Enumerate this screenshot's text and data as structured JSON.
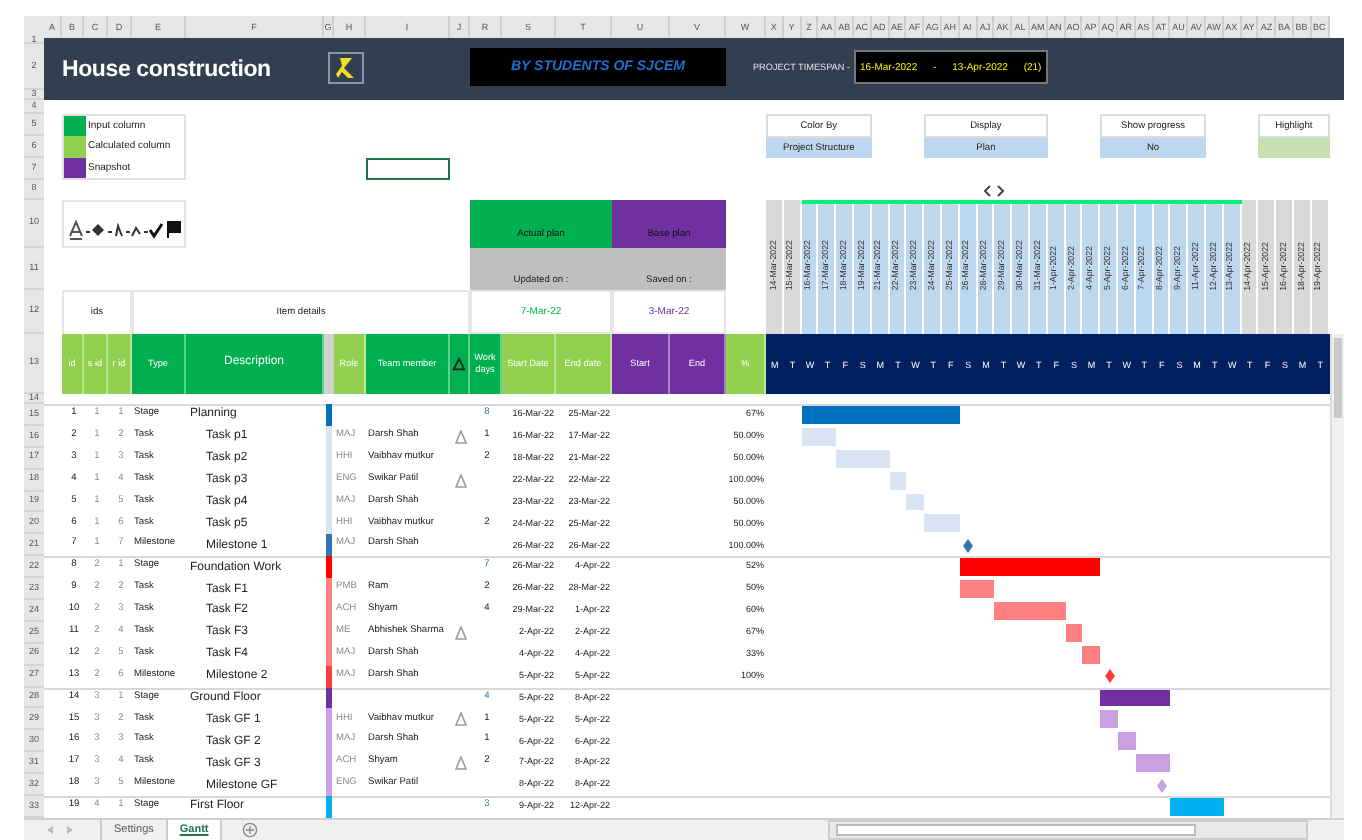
{
  "sheet": {
    "column_letters": [
      "A",
      "B",
      "C",
      "D",
      "E",
      "F",
      "G",
      "H",
      "I",
      "J",
      "R",
      "S",
      "T",
      "U",
      "V",
      "W",
      "X",
      "Y",
      "Z",
      "AA",
      "AB",
      "AC",
      "AD",
      "AE",
      "AF",
      "AG",
      "AH",
      "AI",
      "AJ",
      "AK",
      "AL",
      "AM",
      "AN",
      "AO",
      "AP",
      "AQ",
      "AR",
      "AS",
      "AT",
      "AU",
      "AV",
      "AW",
      "AX",
      "AY",
      "AZ",
      "BA",
      "BB",
      "BC"
    ],
    "row_numbers": [
      "1",
      "2",
      "3",
      "4",
      "5",
      "6",
      "7",
      "8",
      "10",
      "11",
      "12",
      "13",
      "14",
      "15",
      "16",
      "17",
      "18",
      "19",
      "20",
      "21",
      "22",
      "23",
      "24",
      "25",
      "26",
      "27",
      "28",
      "29",
      "30",
      "31",
      "32",
      "33"
    ]
  },
  "title": "House construction",
  "banner": "BY STUDENTS OF SJCEM",
  "timespan": {
    "label": "PROJECT TIMESPAN -",
    "start": "16-Mar-2022",
    "separator": "-",
    "end": "13-Apr-2022",
    "days": "(21)"
  },
  "legend": [
    {
      "label": "Input column",
      "color": "#00b050"
    },
    {
      "label": "Calculated column",
      "color": "#92d050"
    },
    {
      "label": "Snapshot",
      "color": "#7030a0"
    }
  ],
  "selectors": [
    {
      "kind": "dropdown",
      "label": "Color By",
      "value": "Project Structure"
    },
    {
      "kind": "dropdown",
      "label": "Display",
      "value": "Plan"
    },
    {
      "kind": "dropdown",
      "label": "Show progress",
      "value": "No"
    },
    {
      "kind": "swatch",
      "label": "Highlight"
    }
  ],
  "plans": [
    {
      "title": "Actual plan",
      "caption": "Updated on :",
      "date": "7-Mar-22",
      "kind": "actual"
    },
    {
      "title": "Base plan",
      "caption": "Saved on :",
      "date": "3-Mar-22",
      "kind": "base"
    }
  ],
  "group_headers": [
    "ids",
    "Item details"
  ],
  "columns": [
    "id",
    "s id",
    "r id",
    "Type",
    "Description",
    "Role",
    "Team member",
    "Work days",
    "Start Date",
    "End date",
    "Start",
    "End",
    "%"
  ],
  "days": [
    {
      "date": "14-Mar-2022",
      "weekday": "M",
      "highlighted": false
    },
    {
      "date": "15-Mar-2022",
      "weekday": "T",
      "highlighted": false
    },
    {
      "date": "16-Mar-2022",
      "weekday": "W",
      "highlighted": true
    },
    {
      "date": "17-Mar-2022",
      "weekday": "T",
      "highlighted": true
    },
    {
      "date": "18-Mar-2022",
      "weekday": "F",
      "highlighted": true
    },
    {
      "date": "19-Mar-2022",
      "weekday": "S",
      "highlighted": true
    },
    {
      "date": "21-Mar-2022",
      "weekday": "M",
      "highlighted": true
    },
    {
      "date": "22-Mar-2022",
      "weekday": "T",
      "highlighted": true
    },
    {
      "date": "23-Mar-2022",
      "weekday": "W",
      "highlighted": true
    },
    {
      "date": "24-Mar-2022",
      "weekday": "T",
      "highlighted": true
    },
    {
      "date": "25-Mar-2022",
      "weekday": "F",
      "highlighted": true
    },
    {
      "date": "26-Mar-2022",
      "weekday": "S",
      "highlighted": true
    },
    {
      "date": "28-Mar-2022",
      "weekday": "M",
      "highlighted": true
    },
    {
      "date": "29-Mar-2022",
      "weekday": "T",
      "highlighted": true
    },
    {
      "date": "30-Mar-2022",
      "weekday": "W",
      "highlighted": true
    },
    {
      "date": "31-Mar-2022",
      "weekday": "T",
      "highlighted": true
    },
    {
      "date": "1-Apr-2022",
      "weekday": "F",
      "highlighted": true
    },
    {
      "date": "2-Apr-2022",
      "weekday": "S",
      "highlighted": true
    },
    {
      "date": "4-Apr-2022",
      "weekday": "M",
      "highlighted": true
    },
    {
      "date": "5-Apr-2022",
      "weekday": "T",
      "highlighted": true
    },
    {
      "date": "6-Apr-2022",
      "weekday": "W",
      "highlighted": true
    },
    {
      "date": "7-Apr-2022",
      "weekday": "T",
      "highlighted": true
    },
    {
      "date": "8-Apr-2022",
      "weekday": "F",
      "highlighted": true
    },
    {
      "date": "9-Apr-2022",
      "weekday": "S",
      "highlighted": true
    },
    {
      "date": "11-Apr-2022",
      "weekday": "M",
      "highlighted": true
    },
    {
      "date": "12-Apr-2022",
      "weekday": "T",
      "highlighted": true
    },
    {
      "date": "13-Apr-2022",
      "weekday": "W",
      "highlighted": true
    },
    {
      "date": "14-Apr-2022",
      "weekday": "T",
      "highlighted": false
    },
    {
      "date": "15-Apr-2022",
      "weekday": "F",
      "highlighted": false
    },
    {
      "date": "16-Apr-2022",
      "weekday": "S",
      "highlighted": false
    },
    {
      "date": "18-Apr-2022",
      "weekday": "M",
      "highlighted": false
    },
    {
      "date": "19-Apr-2022",
      "weekday": "T",
      "highlighted": false
    }
  ],
  "rows": [
    {
      "id": "1",
      "s_id": "1",
      "r_id": "1",
      "kind": "stage",
      "type": "Stage",
      "description": "Planning",
      "color": "#0070c0",
      "flag": false,
      "work_days": "8",
      "start": "16-Mar-22",
      "end": "25-Mar-22",
      "progress": "67%"
    },
    {
      "id": "2",
      "s_id": "1",
      "r_id": "2",
      "kind": "task",
      "type": "Task",
      "description": "Task p1",
      "color": "#dae3f3",
      "role": "MAJ",
      "member": "Darsh Shah",
      "flag": true,
      "work_days": "1",
      "start": "16-Mar-22",
      "end": "17-Mar-22",
      "progress": "50.00%"
    },
    {
      "id": "3",
      "s_id": "1",
      "r_id": "3",
      "kind": "task",
      "type": "Task",
      "description": "Task p2",
      "color": "#dae3f3",
      "role": "HHI",
      "member": "Vaibhav mutkur",
      "flag": false,
      "work_days": "2",
      "start": "18-Mar-22",
      "end": "21-Mar-22",
      "progress": "50.00%"
    },
    {
      "id": "4",
      "s_id": "1",
      "r_id": "4",
      "kind": "task",
      "type": "Task",
      "description": "Task p3",
      "color": "#dae3f3",
      "role": "ENG",
      "member": "Swikar Patil",
      "flag": true,
      "start": "22-Mar-22",
      "end": "22-Mar-22",
      "progress": "100.00%"
    },
    {
      "id": "5",
      "s_id": "1",
      "r_id": "5",
      "kind": "task",
      "type": "Task",
      "description": "Task p4",
      "color": "#dae3f3",
      "role": "MAJ",
      "member": "Darsh Shah",
      "flag": false,
      "start": "23-Mar-22",
      "end": "23-Mar-22",
      "progress": "50.00%"
    },
    {
      "id": "6",
      "s_id": "1",
      "r_id": "6",
      "kind": "task",
      "type": "Task",
      "description": "Task p5",
      "color": "#dae3f3",
      "role": "HHI",
      "member": "Vaibhav mutkur",
      "flag": false,
      "work_days": "2",
      "start": "24-Mar-22",
      "end": "25-Mar-22",
      "progress": "50.00%"
    },
    {
      "id": "7",
      "s_id": "1",
      "r_id": "7",
      "kind": "milestone",
      "type": "Milestone",
      "description": "Milestone 1",
      "color": "#2e75b6",
      "role": "MAJ",
      "member": "Darsh Shah",
      "flag": false,
      "start": "26-Mar-22",
      "end": "26-Mar-22",
      "progress": "100.00%"
    },
    {
      "id": "8",
      "s_id": "2",
      "r_id": "1",
      "kind": "stage",
      "type": "Stage",
      "description": "Foundation Work",
      "color": "#ff0000",
      "flag": false,
      "work_days": "7",
      "start": "26-Mar-22",
      "end": "4-Apr-22",
      "progress": "52%"
    },
    {
      "id": "9",
      "s_id": "2",
      "r_id": "2",
      "kind": "task",
      "type": "Task",
      "description": "Task F1",
      "color": "#ff8080",
      "role": "PMB",
      "member": "Ram",
      "flag": false,
      "work_days": "2",
      "start": "26-Mar-22",
      "end": "28-Mar-22",
      "progress": "50%"
    },
    {
      "id": "10",
      "s_id": "2",
      "r_id": "3",
      "kind": "task",
      "type": "Task",
      "description": "Task F2",
      "color": "#ff8080",
      "role": "ACH",
      "member": "Shyam",
      "flag": false,
      "work_days": "4",
      "start": "29-Mar-22",
      "end": "1-Apr-22",
      "progress": "60%"
    },
    {
      "id": "11",
      "s_id": "2",
      "r_id": "4",
      "kind": "task",
      "type": "Task",
      "description": "Task F3",
      "color": "#ff8080",
      "role": "ME",
      "member": "Abhishek Sharma",
      "flag": true,
      "start": "2-Apr-22",
      "end": "2-Apr-22",
      "progress": "67%"
    },
    {
      "id": "12",
      "s_id": "2",
      "r_id": "5",
      "kind": "task",
      "type": "Task",
      "description": "Task F4",
      "color": "#ff8080",
      "role": "MAJ",
      "member": "Darsh Shah",
      "flag": false,
      "start": "4-Apr-22",
      "end": "4-Apr-22",
      "progress": "33%"
    },
    {
      "id": "13",
      "s_id": "2",
      "r_id": "6",
      "kind": "milestone",
      "type": "Milestone",
      "description": "Milestone 2",
      "color": "#ff3b3b",
      "role": "MAJ",
      "member": "Darsh Shah",
      "flag": false,
      "start": "5-Apr-22",
      "end": "5-Apr-22",
      "progress": "100%"
    },
    {
      "id": "14",
      "s_id": "3",
      "r_id": "1",
      "kind": "stage",
      "type": "Stage",
      "description": "Ground Floor",
      "color": "#7030a0",
      "flag": false,
      "work_days": "4",
      "start": "5-Apr-22",
      "end": "8-Apr-22"
    },
    {
      "id": "15",
      "s_id": "3",
      "r_id": "2",
      "kind": "task",
      "type": "Task",
      "description": "Task GF 1",
      "color": "#c9a0e0",
      "role": "HHI",
      "member": "Vaibhav mutkur",
      "flag": true,
      "work_days": "1",
      "start": "5-Apr-22",
      "end": "5-Apr-22"
    },
    {
      "id": "16",
      "s_id": "3",
      "r_id": "3",
      "kind": "task",
      "type": "Task",
      "description": "Task GF 2",
      "color": "#c9a0e0",
      "role": "MAJ",
      "member": "Darsh Shah",
      "flag": false,
      "work_days": "1",
      "start": "6-Apr-22",
      "end": "6-Apr-22"
    },
    {
      "id": "17",
      "s_id": "3",
      "r_id": "4",
      "kind": "task",
      "type": "Task",
      "description": "Task GF 3",
      "color": "#c9a0e0",
      "role": "ACH",
      "member": "Shyam",
      "flag": true,
      "work_days": "2",
      "start": "7-Apr-22",
      "end": "8-Apr-22"
    },
    {
      "id": "18",
      "s_id": "3",
      "r_id": "5",
      "kind": "milestone",
      "type": "Milestone",
      "description": "Milestone GF",
      "color": "#c9a0e0",
      "role": "ENG",
      "member": "Swikar Patil",
      "flag": false,
      "start": "8-Apr-22",
      "end": "8-Apr-22"
    },
    {
      "id": "19",
      "s_id": "4",
      "r_id": "1",
      "kind": "stage",
      "type": "Stage",
      "description": "First Floor",
      "color": "#00b0f0",
      "flag": false,
      "work_days": "3",
      "start": "9-Apr-22",
      "end": "12-Apr-22"
    }
  ],
  "sheet_tabs": [
    {
      "label": "Settings",
      "selected": false
    },
    {
      "label": "Gantt",
      "selected": true
    }
  ]
}
